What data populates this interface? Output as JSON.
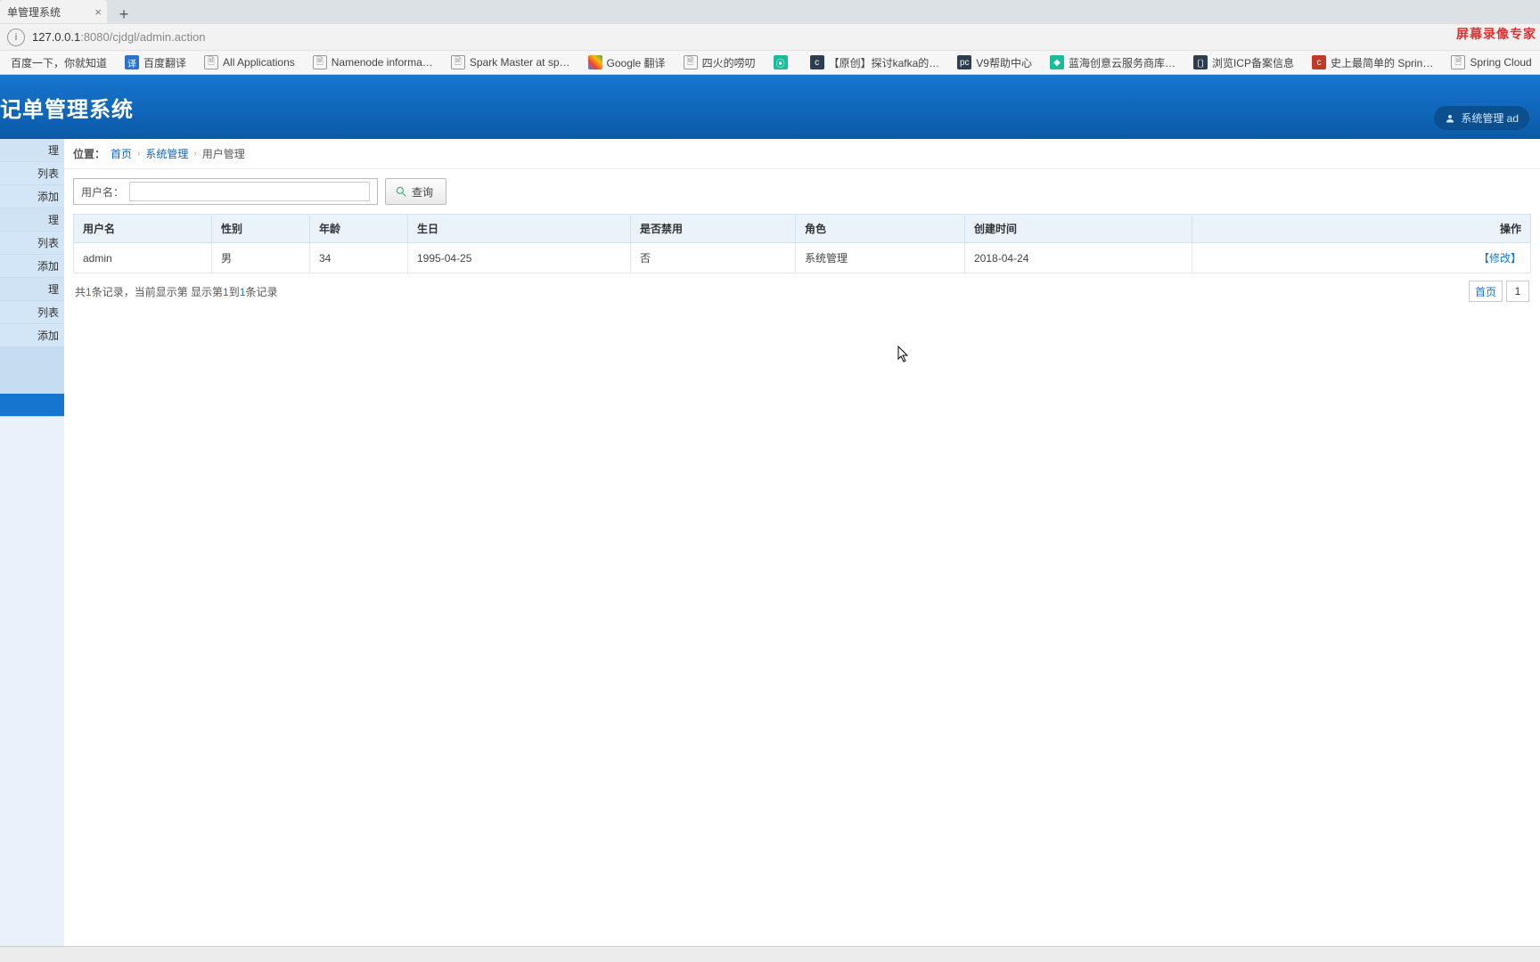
{
  "browser": {
    "tab_title": "单管理系统",
    "url_host": "127.0.0.1",
    "url_port_path": ":8080/cjdgl/admin.action",
    "bookmarks": [
      {
        "label": "百度一下，你就知道",
        "icon": "none"
      },
      {
        "label": "百度翻译",
        "icon": "blue",
        "glyph": "译"
      },
      {
        "label": "All Applications",
        "icon": "file"
      },
      {
        "label": "Namenode informa…",
        "icon": "file"
      },
      {
        "label": "Spark Master at sp…",
        "icon": "file"
      },
      {
        "label": "Google 翻译",
        "icon": "gcolor",
        "glyph": "G"
      },
      {
        "label": "四火的唠叨",
        "icon": "file"
      },
      {
        "label": "",
        "icon": "teal",
        "glyph": "⦿"
      },
      {
        "label": "【原创】探讨kafka的…",
        "icon": "dark",
        "glyph": "c"
      },
      {
        "label": "V9帮助中心",
        "icon": "dark",
        "glyph": "pc"
      },
      {
        "label": "蓝海创意云服务商库…",
        "icon": "teal",
        "glyph": "◆"
      },
      {
        "label": "浏览ICP备案信息",
        "icon": "dark",
        "glyph": "〔〕"
      },
      {
        "label": "史上最简单的 Sprin…",
        "icon": "red",
        "glyph": "c"
      },
      {
        "label": "Spring Cloud",
        "icon": "file"
      }
    ]
  },
  "header": {
    "title": "记单管理系统",
    "user_label": "系统管理 ad"
  },
  "sidebar": {
    "items": [
      {
        "label": "理",
        "type": "head"
      },
      {
        "label": "列表",
        "type": "item"
      },
      {
        "label": "添加",
        "type": "item"
      },
      {
        "label": "理",
        "type": "head"
      },
      {
        "label": "列表",
        "type": "item"
      },
      {
        "label": "添加",
        "type": "item"
      },
      {
        "label": "理",
        "type": "head"
      },
      {
        "label": "列表",
        "type": "item"
      },
      {
        "label": "添加",
        "type": "item"
      },
      {
        "label": "",
        "type": "spacer"
      },
      {
        "label": "",
        "type": "spacer"
      },
      {
        "label": "",
        "type": "active"
      }
    ]
  },
  "breadcrumb": {
    "prefix": "位置：",
    "items": [
      "首页",
      "系统管理",
      "用户管理"
    ]
  },
  "search": {
    "label": "用户名：",
    "value": "",
    "button": "查询"
  },
  "table": {
    "headers": [
      "用户名",
      "性别",
      "年龄",
      "生日",
      "是否禁用",
      "角色",
      "创建时间",
      "操作"
    ],
    "rows": [
      {
        "username": "admin",
        "gender": "男",
        "age": "34",
        "birthday": "1995-04-25",
        "disabled": "否",
        "role": "系统管理",
        "created": "2018-04-24",
        "op": "【修改】"
      }
    ]
  },
  "footer": {
    "text_prefix": "共",
    "total": "1",
    "text_mid1": "条记录，当前显示第  显示第",
    "from": "1",
    "text_mid2": "到",
    "to": "1",
    "text_suffix": "条记录"
  },
  "pager": {
    "first": "首页",
    "page": "1"
  },
  "watermark": "屏幕录像专家"
}
